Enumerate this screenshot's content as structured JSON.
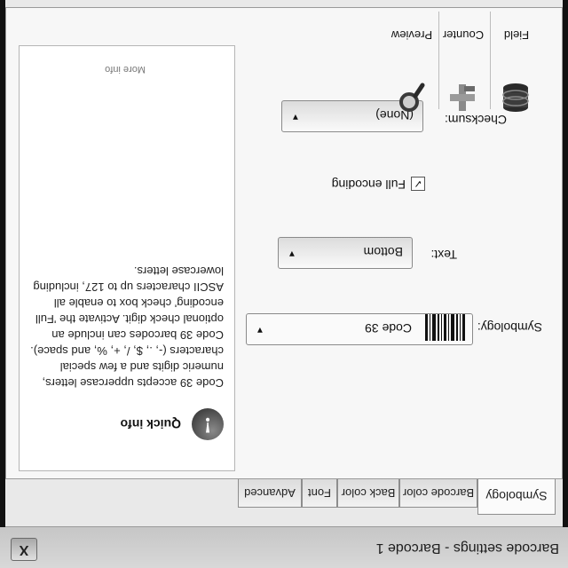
{
  "window": {
    "title": "Barcode settings - Barcode 1",
    "close_label": "X"
  },
  "tabs": [
    {
      "label": "Symbology",
      "active": true
    },
    {
      "label": "Barcode color",
      "active": false
    },
    {
      "label": "Back color",
      "active": false
    },
    {
      "label": "Font",
      "active": false
    },
    {
      "label": "Advanced",
      "active": false
    }
  ],
  "tools": [
    {
      "label": "Field",
      "icon": "database-icon"
    },
    {
      "label": "Counter",
      "icon": "counter-icon"
    },
    {
      "label": "Preview",
      "icon": "magnifier-icon"
    }
  ],
  "form": {
    "symbology_label": "Symbology:",
    "symbology_value": "Code 39",
    "text_label": "Text:",
    "text_value": "Bottom",
    "full_encoding_label": "Full encoding",
    "full_encoding_checked": true,
    "checksum_label": "Checksum:",
    "checksum_value": "(None)"
  },
  "quick_info": {
    "title": "Quick info",
    "text": "Code 39 accepts uppercase letters, numeric digits and a few special characters (-, ., $, /, +, %, and space). Code 39 barcodes can include an optional check digit. Activate the 'Full encoding' check box to enable all ASCII characters up to 127, including lowercase letters.",
    "more": "More info"
  }
}
